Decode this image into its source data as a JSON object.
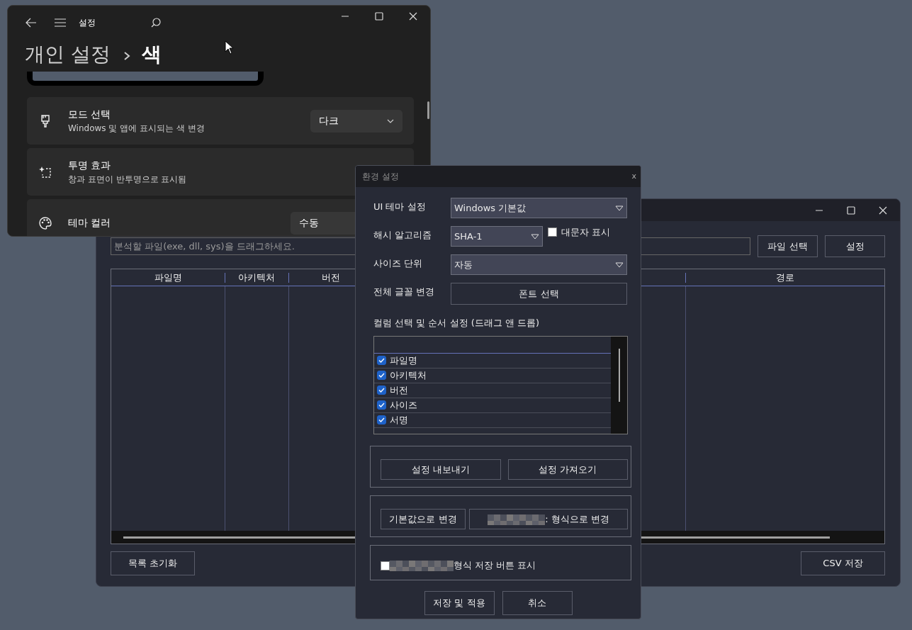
{
  "settings_window": {
    "title": "설정",
    "breadcrumb": [
      "개인 설정",
      "색"
    ],
    "rows": [
      {
        "title": "모드 선택",
        "subtitle": "Windows 및 앱에 표시되는 색 변경",
        "value": "다크"
      },
      {
        "title": "투명 효과",
        "subtitle": "창과 표면이 반투명으로 표시됨"
      },
      {
        "title": "테마 컬러",
        "value": "수동"
      }
    ]
  },
  "main_window": {
    "drop_field": {
      "placeholder": "분석할 파일(exe, dll, sys)을 드래그하세요."
    },
    "buttons": [
      "파일 선택",
      "설정"
    ],
    "table": {
      "columns": [
        "파일명",
        "아키텍처",
        "버전",
        "",
        "경로"
      ]
    },
    "footer_buttons": [
      "목록 초기화",
      "CSV 저장"
    ]
  },
  "dialog": {
    "title": "환경 설정",
    "close": "x",
    "fields": [
      {
        "label": "UI 테마 설정",
        "kind": "select",
        "value": "Windows 기본값"
      },
      {
        "label": "해시 알고리즘",
        "kind": "select",
        "value": "SHA-1",
        "checkbox": {
          "label": "대문자 표시",
          "checked": false
        }
      },
      {
        "label": "사이즈 단위",
        "kind": "select",
        "value": "자동"
      },
      {
        "label": "전체 글꼴 변경",
        "kind": "button",
        "value": "폰트 선택"
      }
    ],
    "columns_label": "컬럼 선택 및 순서 설정 (드래그 앤 드롭)",
    "column_items": [
      {
        "label": "파일명",
        "checked": true
      },
      {
        "label": "아키텍처",
        "checked": true
      },
      {
        "label": "버전",
        "checked": true
      },
      {
        "label": "사이즈",
        "checked": true
      },
      {
        "label": "서명",
        "checked": true
      }
    ],
    "groups": [
      {
        "kind": "buttons",
        "buttons": [
          {
            "label": "설정 내보내기",
            "redacted": false
          },
          {
            "label": "설정 가져오기",
            "redacted": false
          }
        ]
      },
      {
        "kind": "buttons",
        "buttons": [
          {
            "label": "기본값으로 변경",
            "redacted": false
          },
          {
            "label": ": 형식으로 변경",
            "redacted": true
          }
        ]
      },
      {
        "kind": "checkbox",
        "label": "형식 저장 버튼 표시",
        "checked": false,
        "redacted": true
      }
    ],
    "buttons": [
      "저장 및 적용",
      "취소"
    ]
  }
}
